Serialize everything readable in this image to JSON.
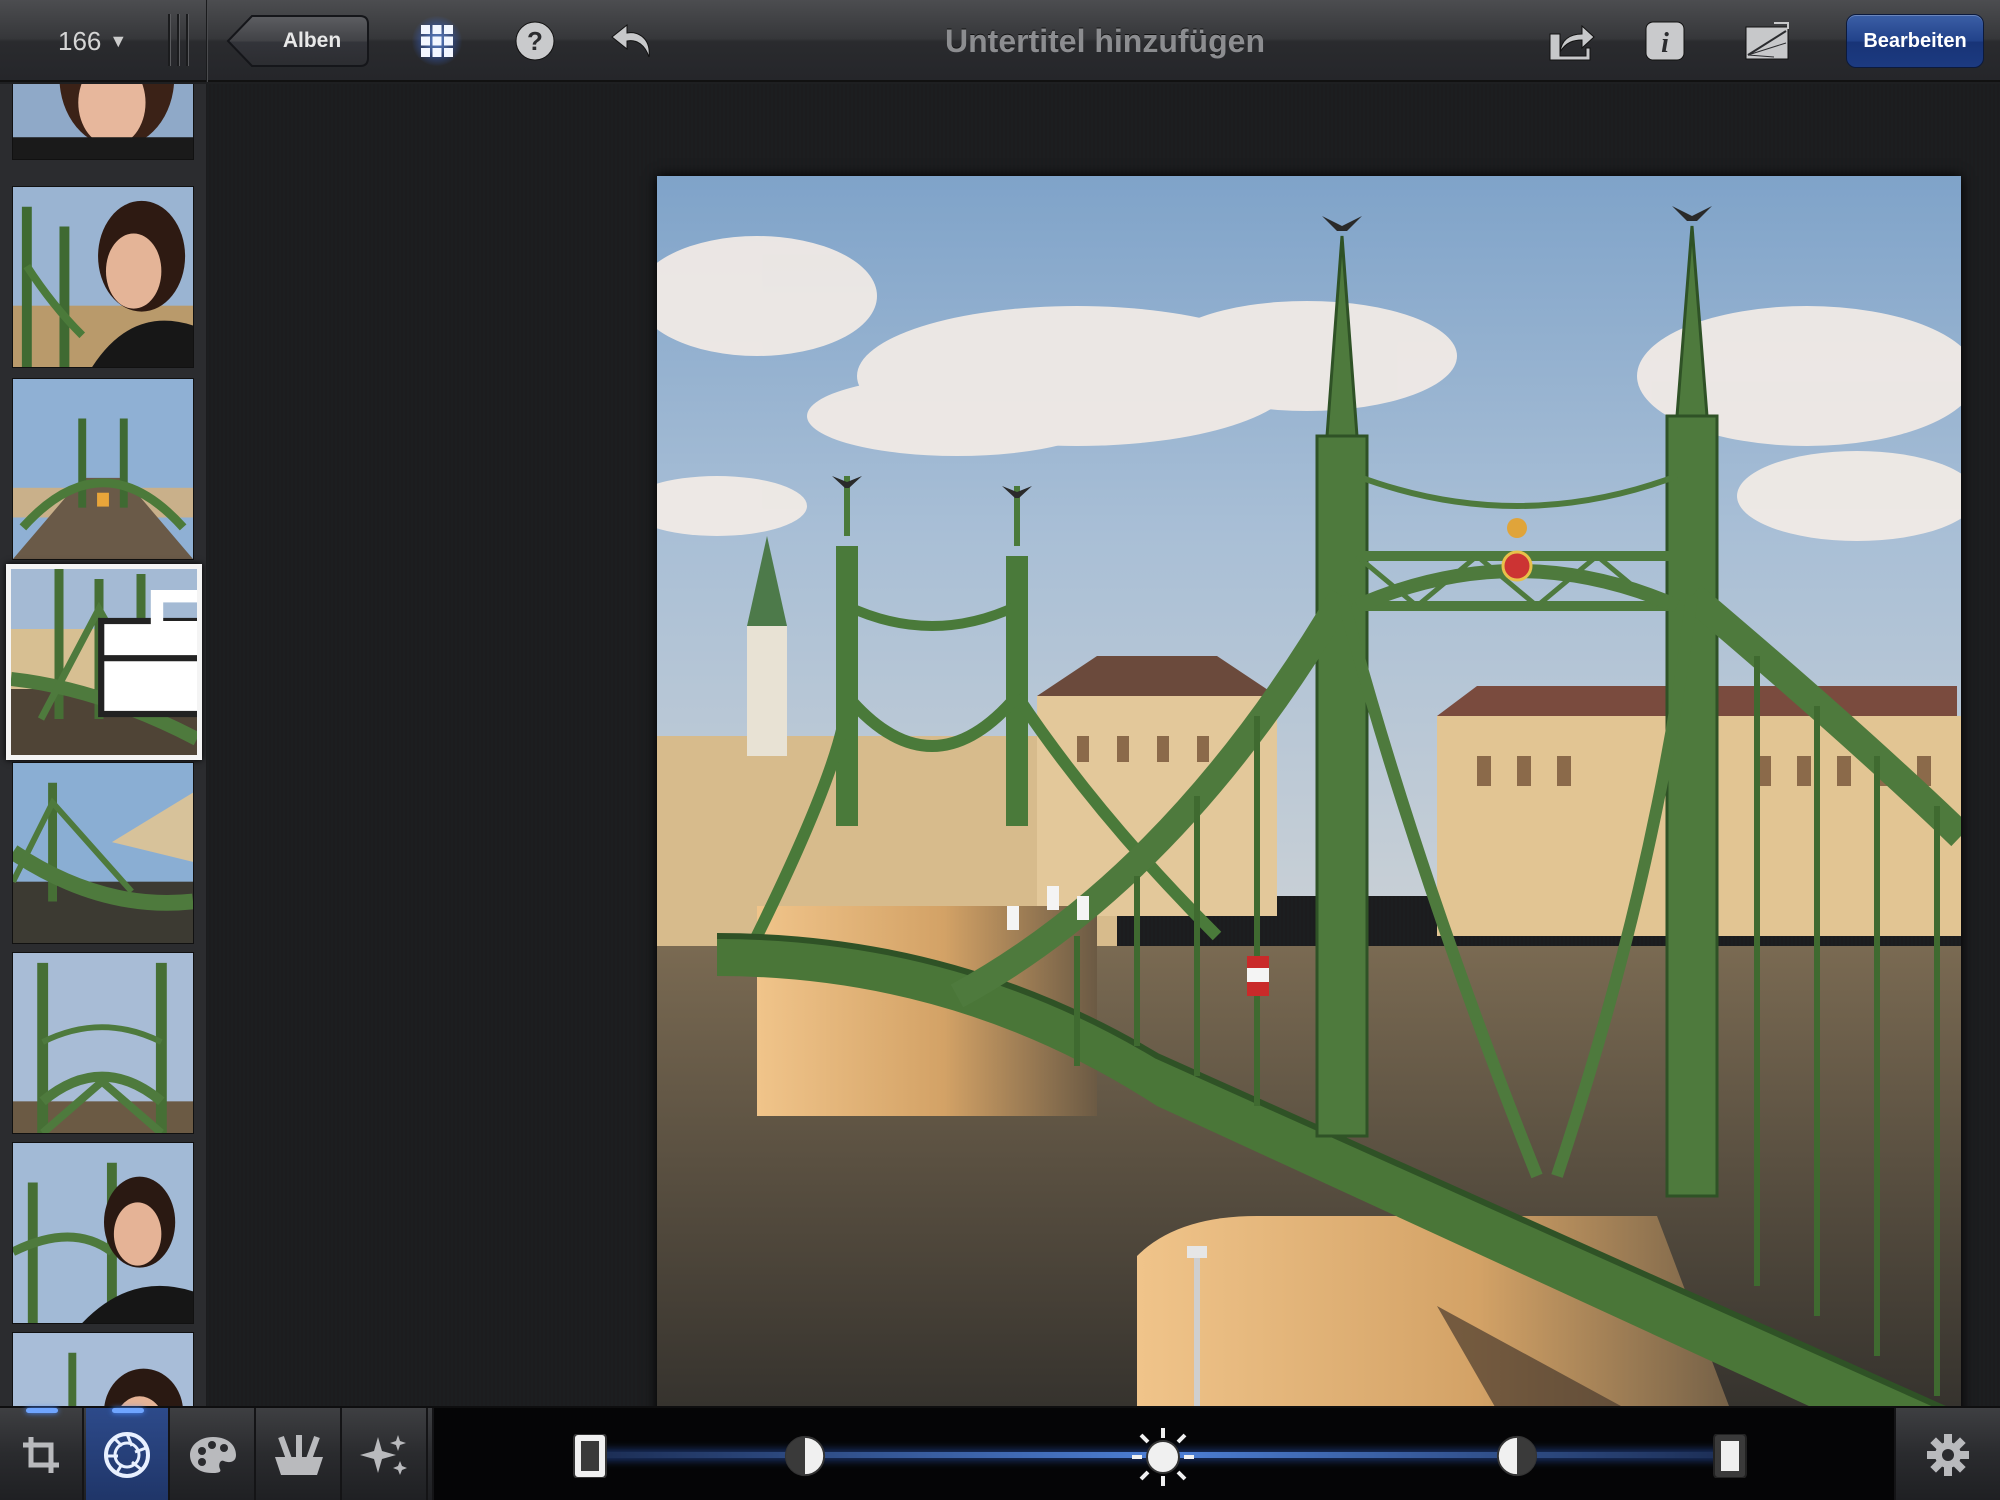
{
  "toolbar": {
    "photo_count": "166",
    "back_label": "Alben",
    "title": "Untertitel hinzufügen",
    "edit_label": "Bearbeiten"
  },
  "icons": {
    "grid": "grid-icon",
    "help": "help-icon",
    "undo": "undo-icon",
    "share": "share-icon",
    "info": "info-icon",
    "journal": "journal-icon",
    "crop": "crop-icon",
    "exposure": "aperture-icon",
    "color": "palette-icon",
    "brushes": "brushes-icon",
    "effects": "sparkle-icon",
    "settings": "gear-icon"
  },
  "sidebar": {
    "selected_index": 3,
    "thumbnails": [
      {
        "subject": "portrait"
      },
      {
        "subject": "portrait-bridge"
      },
      {
        "subject": "bridge-deck"
      },
      {
        "subject": "bridge",
        "edited": true
      },
      {
        "subject": "bridge-angle"
      },
      {
        "subject": "bridge-towers"
      },
      {
        "subject": "portrait-bridge"
      },
      {
        "subject": "portrait"
      }
    ]
  },
  "exposure_slider": {
    "handles": [
      "shadows",
      "contrast-left",
      "brightness",
      "contrast-right",
      "highlights"
    ]
  },
  "colors": {
    "accent": "#3f6fd8",
    "edit_button": "#22428a",
    "bridge_green": "#4e7a3d"
  }
}
